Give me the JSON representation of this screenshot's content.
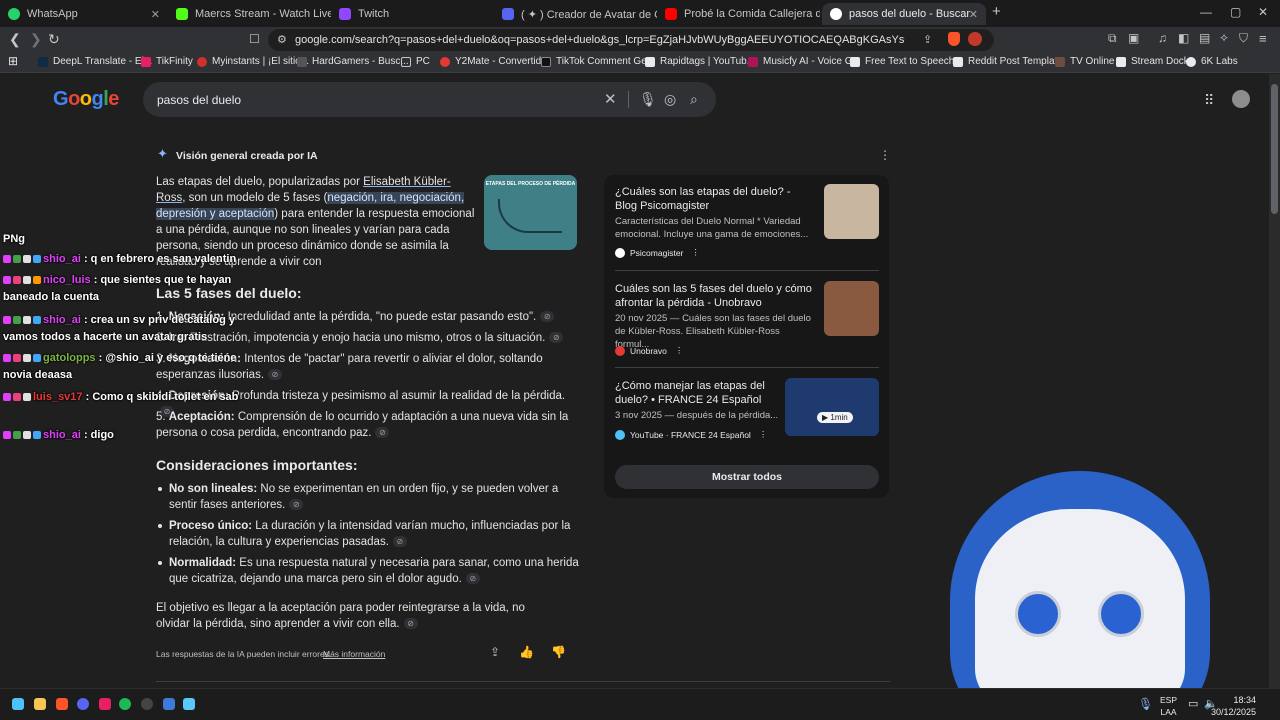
{
  "tabs": [
    {
      "title": "WhatsApp",
      "color": "#25d366"
    },
    {
      "title": "Maercs Stream - Watch Live on K",
      "color": "#53fc18"
    },
    {
      "title": "Twitch",
      "color": "#9146ff"
    },
    {
      "title": "( ✦ ) Creador de Avatar de Catálogo",
      "color": "#5865f2"
    },
    {
      "title": "Probé la Comida Callejera de TODO",
      "color": "#ff0000"
    },
    {
      "title": "pasos del duelo - Buscar con Go",
      "color": "#ffffff"
    }
  ],
  "toolbar": {
    "url": "google.com/search?q=pasos+del+duelo&oq=pasos+del+duelo&gs_lcrp=EgZjaHJvbWUyBggAEEUYOTIOCAEQABgKGAsYsQMYgAQyCwgCEAAYChgL..."
  },
  "bookmarks": [
    "DeepL Translate - El...",
    "TikFinity",
    "Myinstants | ¡El sitio...",
    "HardGamers - Busc...",
    "PC",
    "Y2Mate - Convertid...",
    "TikTok Comment Ge...",
    "Rapidtags | YouTub...",
    "Musicfy AI - Voice G...",
    "Free Text to Speech...",
    "Reddit Post Templat...",
    "TV Online",
    "Stream Dock",
    "6K Labs"
  ],
  "search": {
    "logo": "Google",
    "query": "pasos del duelo"
  },
  "ai_overview": {
    "header": "Visión general creada por IA",
    "intro_1": "Las etapas del duelo, popularizadas por ",
    "intro_link": "Elisabeth Kübler-Ross",
    "intro_2": ", son un modelo de 5 fases (",
    "intro_hl": "negación, ira, negociación, depresión y aceptación",
    "intro_3": ") para entender la respuesta emocional a una pérdida, aunque no son lineales y varían para cada persona, siendo un proceso dinámico donde se asimila la realidad y se aprende a vivir con",
    "phases_title": "Las 5 fases del duelo:",
    "phases": [
      {
        "n": "1.",
        "name": "Negación:",
        "text": " Incredulidad ante la pérdida, \"no puede estar pasando esto\"."
      },
      {
        "n": "2.",
        "name": "Ira:",
        "text": " Frustración, impotencia y enojo hacia uno mismo, otros o la situación."
      },
      {
        "n": "3.",
        "name": "Negociación:",
        "text": " Intentos de \"pactar\" para revertir o aliviar el dolor, soltando esperanzas ilusorias."
      },
      {
        "n": "4.",
        "name": "Depresión:",
        "text": " Profunda tristeza y pesimismo al asumir la realidad de la pérdida."
      },
      {
        "n": "5.",
        "name": "Aceptación:",
        "text": " Comprensión de lo ocurrido y adaptación a una nueva vida sin la persona o cosa perdida, encontrando paz."
      }
    ],
    "considerations_title": "Consideraciones importantes:",
    "considerations": [
      {
        "name": "No son lineales:",
        "text": " No se experimentan en un orden fijo, y se pueden volver a sentir fases anteriores."
      },
      {
        "name": "Proceso único:",
        "text": " La duración y la intensidad varían mucho, influenciadas por la relación, la cultura y experiencias pasadas."
      },
      {
        "name": "Normalidad:",
        "text": " Es una respuesta natural y necesaria para sanar, como una herida que cicatriza, dejando una marca pero sin el dolor agudo."
      }
    ],
    "closing": "El objetivo es llegar a la aceptación para poder reintegrarse a la vida, no olvidar la pérdida, sino aprender a vivir con ella.",
    "disclaimer": "Las respuestas de la IA pueden incluir errores.",
    "more_info": "Más información",
    "image_title": "ETAPAS DEL PROCESO DE PÉRDIDA"
  },
  "sources": [
    {
      "title": "¿Cuáles son las etapas del duelo? - Blog Psicomagister",
      "snippet": "Características del Duelo Normal * Variedad emocional. Incluye una gama de emociones...",
      "site": "Psicomagister",
      "color": "#c8b6a0",
      "fav": "#ffffff"
    },
    {
      "title": "Cuáles son las 5 fases del duelo y cómo afrontar la pérdida - Unobravo",
      "snippet": "20 nov 2025 — Cuáles son las fases del duelo de Kübler-Ross. Elisabeth Kübler-Ross formul...",
      "site": "Unobravo",
      "color": "#8a5a40",
      "fav": "#e53935"
    },
    {
      "title": "¿Cómo manejar las etapas del duelo? • FRANCE 24 Español",
      "snippet": "3 nov 2025 — después de la pérdida...",
      "site": "YouTube",
      "site2": "FRANCE 24 Español",
      "duration": "1min",
      "color": "#1e3a6e",
      "fav": "#4fc3f7"
    }
  ],
  "show_all": "Mostrar todos",
  "chat": [
    {
      "user": "",
      "msg": "PNg"
    },
    {
      "user": "shio_ai",
      "msg": " : q en febrero es san valentin",
      "cls": "user-m"
    },
    {
      "user": "nico_luis",
      "msg": " : que sientes que te hayan",
      "cls": "user-m"
    },
    {
      "user": "",
      "msg": "baneado la cuenta"
    },
    {
      "user": "shio_ai",
      "msg": " : crea un sv priv de catalog y",
      "cls": "user-m"
    },
    {
      "user": "",
      "msg": "vamos todos a hacerte un avatar gratis"
    },
    {
      "user": "gatolopps",
      "msg": " : @shio_ai y eso q te tiene",
      "cls": "user-g"
    },
    {
      "user": "",
      "msg": "novia deaasa"
    },
    {
      "user": "luis_sv17",
      "msg": " : Como q skibidi toilet en sab",
      "cls": "user-r"
    },
    {
      "user": "shio_ai",
      "msg": " : digo",
      "cls": "user-m"
    }
  ],
  "taskbar": {
    "lang1": "ESP",
    "lang2": "LAA",
    "time": "18:34",
    "date": "30/12/2025"
  }
}
